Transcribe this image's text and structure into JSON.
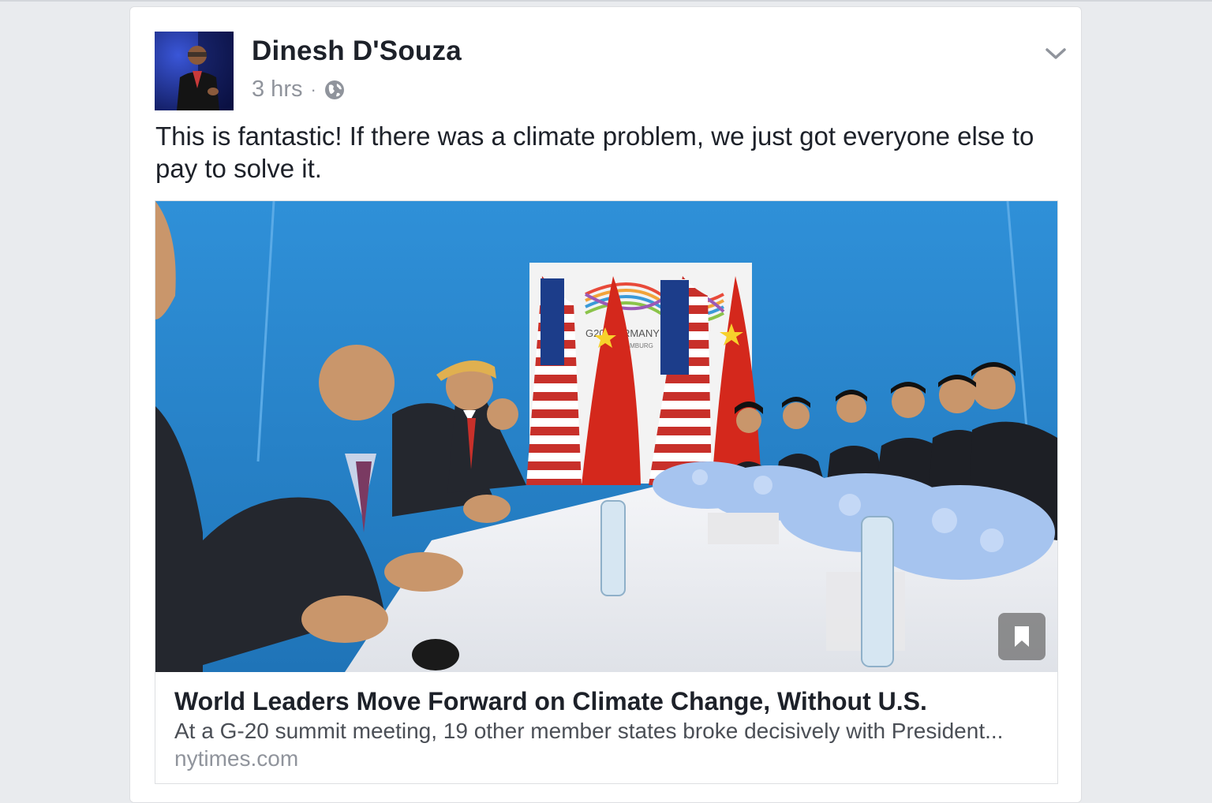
{
  "post": {
    "author_name": "Dinesh D'Souza",
    "timestamp": "3 hrs",
    "separator": "·",
    "privacy_icon": "globe-icon",
    "menu_icon": "chevron-down-icon",
    "message": "This is fantastic! If there was a climate problem, we just got everyone else to pay to solve it."
  },
  "link": {
    "title": "World Leaders Move Forward on Climate Change, Without U.S.",
    "description": "At a G-20 summit meeting, 19 other member states broke decisively with President...",
    "domain": "nytimes.com",
    "save_icon": "bookmark-icon"
  },
  "image": {
    "backdrop_text_1": "G20 GERMANY",
    "backdrop_text_2": "HAMBURG"
  },
  "colors": {
    "backdrop_blue": "#2b8ad0",
    "flag_red": "#d4281c",
    "text_primary": "#1d2129",
    "text_secondary": "#90949c"
  }
}
